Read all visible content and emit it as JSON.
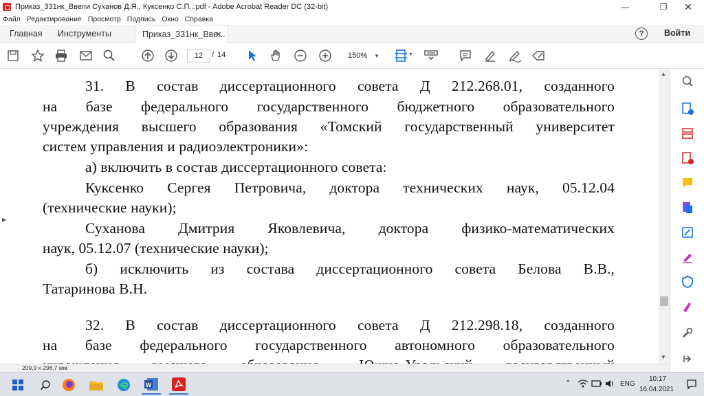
{
  "window": {
    "title": "Приказ_331нк_Ввели Суханов Д.Я., Куксенко С.П...pdf - Adobe Acrobat Reader DC (32-bit)"
  },
  "menu": [
    "Файл",
    "Редактирование",
    "Просмотр",
    "Подпись",
    "Окно",
    "Справка"
  ],
  "tabs": {
    "home": "Главная",
    "tools": "Инструменты",
    "document": "Приказ_331нк_Вве...",
    "help_glyph": "?",
    "signin": "Войти"
  },
  "toolbar": {
    "page_current": "12",
    "page_sep": "/",
    "page_total": "14",
    "zoom": "150%"
  },
  "document": {
    "lines": [
      "31. В состав диссертационного совета Д 212.268.01, созданного",
      "на базе федерального государственного бюджетного образовательного",
      "учреждения высшего образования «Томский государственный университет",
      "систем управления и радиоэлектроники»:",
      "а)  включить в состав диссертационного совета:",
      "Куксенко Сергея Петровича, доктора технических наук, 05.12.04",
      "(технические науки);",
      "Суханова Дмитрия Яковлевича, доктора физико-математических",
      "наук, 05.12.07 (технические науки);",
      "б) исключить из состава диссертационного совета Белова В.В.,",
      "Татаринова В.Н.",
      "32. В состав диссертационного совета Д 212.298.18, созданного",
      "на базе федерального государственного автономного образовательного",
      "учреждения высшего образования «Южно-Уральский государственный"
    ]
  },
  "status": {
    "page_size": "209,9 x 296,7 мм"
  },
  "taskbar": {
    "lang": "ENG",
    "time": "10:17",
    "date": "16.04.2021"
  },
  "colors": {
    "acrobat_red": "#d92323",
    "link_blue": "#1473e6"
  }
}
